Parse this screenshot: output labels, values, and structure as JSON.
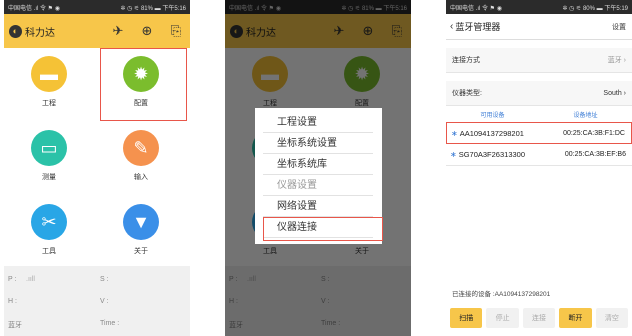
{
  "status": {
    "left": "中国电信 .ıl 令 ⚑ ◉",
    "right": "✲ ◷ ⚟ 81% ▬ 下午5:16"
  },
  "status3": {
    "left": "中国电信 .ıl 令 ⚑ ◉",
    "right": "✲ ◷ ⚟ 80% ▬ 下午5:19"
  },
  "app": {
    "title": "科力达",
    "logo": "◐"
  },
  "home_items": [
    {
      "label": "工程",
      "icon": "folder-icon",
      "color": "#f5c236"
    },
    {
      "label": "配置",
      "icon": "gear-icon",
      "color": "#7bbd2d"
    },
    {
      "label": "测量",
      "icon": "ruler-icon",
      "color": "#2bc2a8"
    },
    {
      "label": "输入",
      "icon": "edit-icon",
      "color": "#f5924e"
    },
    {
      "label": "工具",
      "icon": "tools-icon",
      "color": "#29a6e6"
    },
    {
      "label": "关于",
      "icon": "info-icon",
      "color": "#3a8fe8"
    }
  ],
  "info": {
    "p": "P :",
    "signal": ".ııll",
    "s": "S :",
    "h": "H :",
    "v": "V :",
    "bt": "蓝牙",
    "time": "Time :"
  },
  "menu": [
    {
      "label": "工程设置",
      "disabled": false
    },
    {
      "label": "坐标系统设置",
      "disabled": false
    },
    {
      "label": "坐标系统库",
      "disabled": false
    },
    {
      "label": "仪器设置",
      "disabled": true
    },
    {
      "label": "网络设置",
      "disabled": false
    },
    {
      "label": "仪器连接",
      "disabled": false
    }
  ],
  "bt": {
    "back": "‹",
    "title": "蓝牙管理器",
    "settings": "设置",
    "conn_label": "连接方式",
    "conn_value": "蓝牙 ›",
    "type_label": "仪器类型:",
    "type_value": "South ›",
    "col_devices": "可用设备",
    "col_address": "设备地址",
    "devices": [
      {
        "name": "AA1094137298201",
        "mac": "00:25:CA:3B:F1:DC"
      },
      {
        "name": "SG70A3F26313300",
        "mac": "00:25:CA:3B:EF:B6"
      }
    ],
    "connected": "已连接的设备 :AA1094137298201",
    "buttons": [
      "扫描",
      "停止",
      "连接",
      "断开",
      "清空"
    ]
  }
}
